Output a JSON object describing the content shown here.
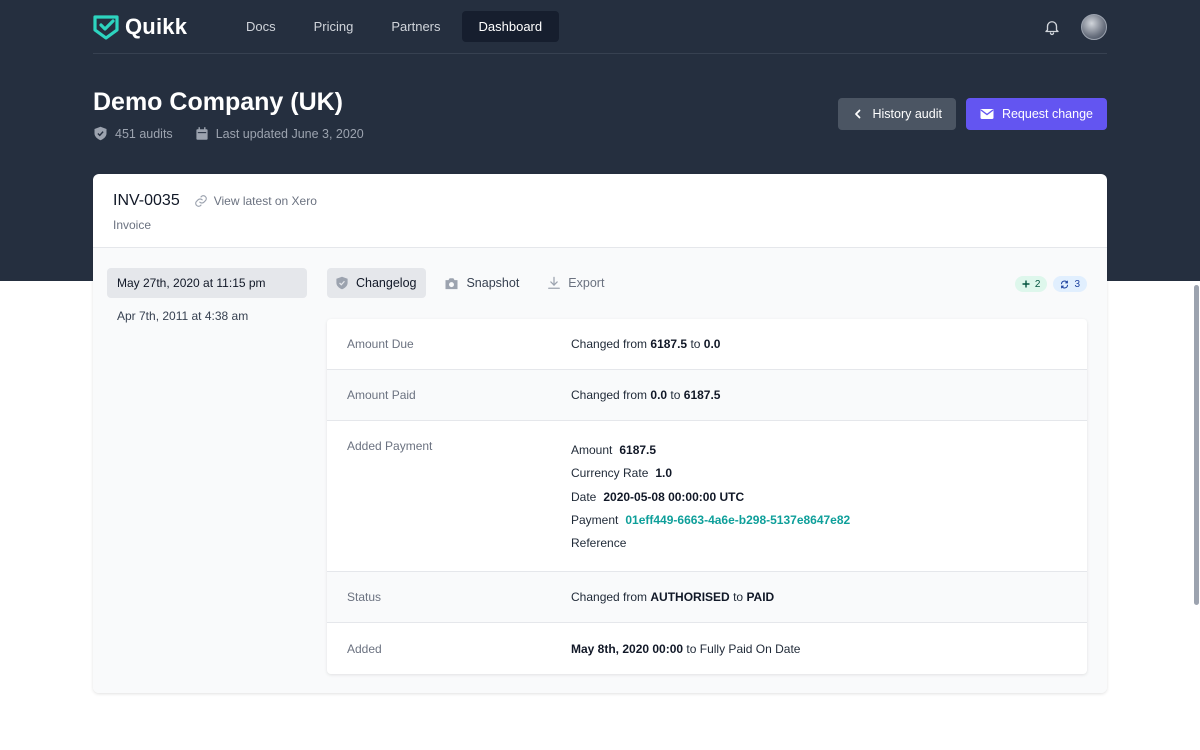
{
  "nav": {
    "brand": "Quikk",
    "links": [
      "Docs",
      "Pricing",
      "Partners",
      "Dashboard"
    ],
    "active_link": "Dashboard"
  },
  "company": {
    "title": "Demo Company (UK)",
    "audits": "451 audits",
    "last_updated": "Last updated June 3, 2020"
  },
  "actions": {
    "history_audit": "History audit",
    "request_change": "Request change"
  },
  "invoice": {
    "number": "INV-0035",
    "xero_link": "View latest on Xero",
    "type": "Invoice"
  },
  "dates": [
    "May 27th, 2020 at 11:15 pm",
    "Apr 7th, 2011 at 4:38 am"
  ],
  "tabs": {
    "changelog": "Changelog",
    "snapshot": "Snapshot",
    "export": "Export"
  },
  "badges": {
    "added": "2",
    "updated": "3"
  },
  "changes": {
    "amount_due": {
      "label": "Amount Due",
      "prefix": "Changed from",
      "from": "6187.5",
      "mid": "to",
      "to": "0.0"
    },
    "amount_paid": {
      "label": "Amount Paid",
      "prefix": "Changed from",
      "from": "0.0",
      "mid": "to",
      "to": "6187.5"
    },
    "payment": {
      "label": "Added Payment",
      "amount_key": "Amount",
      "amount_val": "6187.5",
      "rate_key": "Currency Rate",
      "rate_val": "1.0",
      "date_key": "Date",
      "date_val": "2020-05-08 00:00:00 UTC",
      "payment_key": "Payment",
      "payment_val": "01eff449-6663-4a6e-b298-5137e8647e82",
      "reference_key": "Reference"
    },
    "status": {
      "label": "Status",
      "prefix": "Changed from",
      "from": "AUTHORISED",
      "mid": "to",
      "to": "PAID"
    },
    "added": {
      "label": "Added",
      "value": "May 8th, 2020 00:00",
      "suffix": "to Fully Paid On Date"
    }
  },
  "colors": {
    "header_bg": "#252f3f",
    "primary": "#6355f1",
    "brand_teal": "#0e9f9a"
  },
  "icons": [
    "bell-icon",
    "shield-icon",
    "calendar-icon",
    "chevron-left-icon",
    "mail-icon",
    "link-icon",
    "camera-icon",
    "download-icon",
    "plus-icon",
    "refresh-icon"
  ]
}
